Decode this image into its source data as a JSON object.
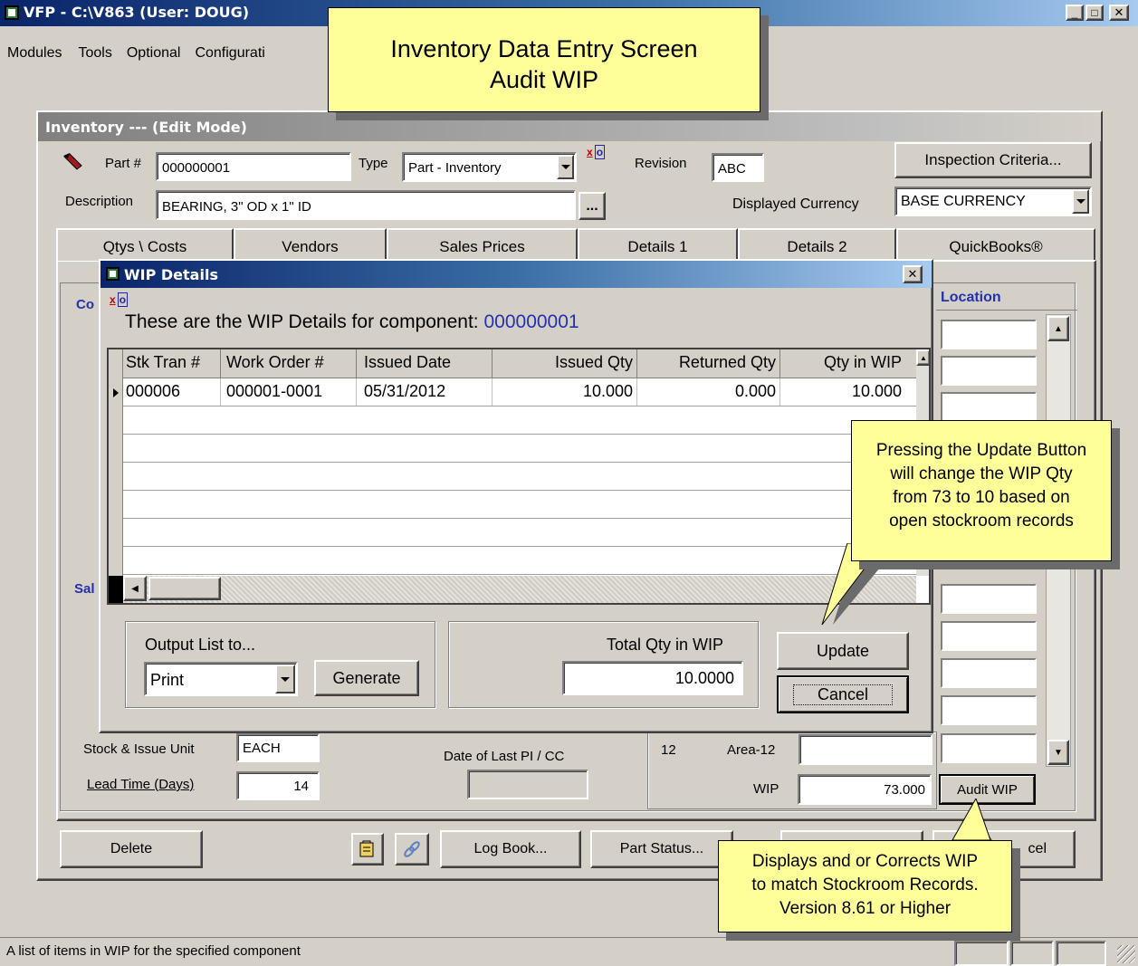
{
  "titlebar": {
    "title": "VFP - C:\\V863  (User: DOUG)"
  },
  "menu": [
    "Modules",
    "Tools",
    "Optional",
    "Configurati"
  ],
  "callout_top": {
    "line1": "Inventory Data Entry Screen",
    "line2": "Audit WIP"
  },
  "inv": {
    "title": "Inventory --- (Edit Mode)",
    "part_label": "Part #",
    "part_value": "000000001",
    "type_label": "Type",
    "type_value": "Part - Inventory",
    "revision_label": "Revision",
    "revision_value": "ABC",
    "inspection_button": "Inspection Criteria...",
    "desc_label": "Description",
    "desc_value": "BEARING, 3\" OD x 1\" ID",
    "ellipsis": "...",
    "currency_label": "Displayed Currency",
    "currency_value": "BASE CURRENCY",
    "tabs": [
      "Qtys \\ Costs",
      "Vendors",
      "Sales Prices",
      "Details 1",
      "Details 2",
      "QuickBooks®"
    ],
    "location_header": "Location",
    "co_label": "Co",
    "sa_label": "Sal",
    "stock_unit_label": "Stock & Issue Unit",
    "stock_unit_value": "EACH",
    "lead_time_label": "Lead Time (Days)",
    "lead_time_value": "14",
    "last_pi_label": "Date of Last PI / CC",
    "area_num": "12",
    "area_label": "Area-12",
    "wip_label": "WIP",
    "wip_value": "73.000",
    "audit_button": "Audit WIP",
    "buttons": {
      "delete": "Delete",
      "logbook": "Log Book...",
      "partstatus": "Part Status...",
      "cancel": "Cancel"
    }
  },
  "wip": {
    "title": "WIP Details",
    "heading": "These are the WIP Details for component:",
    "component": "000000001",
    "columns": [
      "Stk Tran #",
      "Work Order #",
      "Issued Date",
      "Issued Qty",
      "Returned Qty",
      "Qty in WIP"
    ],
    "rows": [
      [
        "000006",
        "000001-0001",
        "05/31/2012",
        "10.000",
        "0.000",
        "10.000"
      ]
    ],
    "output_label": "Output List to...",
    "output_value": "Print",
    "generate_button": "Generate",
    "total_label": "Total Qty in WIP",
    "total_value": "10.0000",
    "update_button": "Update",
    "cancel_button": "Cancel"
  },
  "callout_update": {
    "lines": [
      "Pressing the Update Button",
      "will change  the WIP Qty",
      "from 73 to 10 based on",
      "open stockroom records"
    ]
  },
  "callout_audit": {
    "lines": [
      "Displays and or Corrects  WIP",
      "to match Stockroom Records.",
      "Version 8.61 or Higher"
    ]
  },
  "status": {
    "text": "A list of items in WIP for the specified component"
  },
  "colors": {
    "titlebar": "#0a246a",
    "titlebar_end": "#a6caf0",
    "callout": "#ffff99",
    "blue_text": "#2430b0",
    "face": "#d4d0c8"
  }
}
